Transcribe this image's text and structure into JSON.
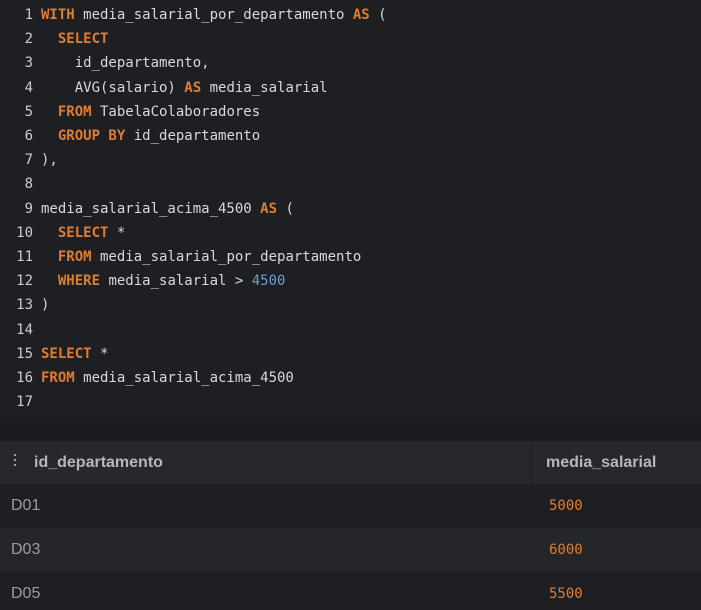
{
  "editor": {
    "lines": [
      {
        "num": "1",
        "tokens": [
          {
            "t": "kw",
            "v": "WITH"
          },
          {
            "t": "plain",
            "v": " media_salarial_por_departamento "
          },
          {
            "t": "kw",
            "v": "AS"
          },
          {
            "t": "plain",
            "v": " ("
          }
        ]
      },
      {
        "num": "2",
        "tokens": [
          {
            "t": "plain",
            "v": "  "
          },
          {
            "t": "kw",
            "v": "SELECT"
          }
        ]
      },
      {
        "num": "3",
        "tokens": [
          {
            "t": "plain",
            "v": "    id_departamento,"
          }
        ]
      },
      {
        "num": "4",
        "tokens": [
          {
            "t": "plain",
            "v": "    AVG(salario) "
          },
          {
            "t": "kw",
            "v": "AS"
          },
          {
            "t": "plain",
            "v": " media_salarial"
          }
        ]
      },
      {
        "num": "5",
        "tokens": [
          {
            "t": "plain",
            "v": "  "
          },
          {
            "t": "kw",
            "v": "FROM"
          },
          {
            "t": "plain",
            "v": " TabelaColaboradores"
          }
        ]
      },
      {
        "num": "6",
        "tokens": [
          {
            "t": "plain",
            "v": "  "
          },
          {
            "t": "kw",
            "v": "GROUP BY"
          },
          {
            "t": "plain",
            "v": " id_departamento"
          }
        ]
      },
      {
        "num": "7",
        "tokens": [
          {
            "t": "plain",
            "v": "),"
          }
        ]
      },
      {
        "num": "8",
        "tokens": []
      },
      {
        "num": "9",
        "tokens": [
          {
            "t": "plain",
            "v": "media_salarial_acima_4500 "
          },
          {
            "t": "kw",
            "v": "AS"
          },
          {
            "t": "plain",
            "v": " ("
          }
        ]
      },
      {
        "num": "10",
        "tokens": [
          {
            "t": "plain",
            "v": "  "
          },
          {
            "t": "kw",
            "v": "SELECT"
          },
          {
            "t": "plain",
            "v": " *"
          }
        ]
      },
      {
        "num": "11",
        "tokens": [
          {
            "t": "plain",
            "v": "  "
          },
          {
            "t": "kw",
            "v": "FROM"
          },
          {
            "t": "plain",
            "v": " media_salarial_por_departamento"
          }
        ]
      },
      {
        "num": "12",
        "tokens": [
          {
            "t": "plain",
            "v": "  "
          },
          {
            "t": "kw",
            "v": "WHERE"
          },
          {
            "t": "plain",
            "v": " media_salarial > "
          },
          {
            "t": "num",
            "v": "4500"
          }
        ]
      },
      {
        "num": "13",
        "tokens": [
          {
            "t": "plain",
            "v": ")"
          }
        ]
      },
      {
        "num": "14",
        "tokens": []
      },
      {
        "num": "15",
        "tokens": [
          {
            "t": "kw",
            "v": "SELECT"
          },
          {
            "t": "plain",
            "v": " *"
          }
        ]
      },
      {
        "num": "16",
        "tokens": [
          {
            "t": "kw",
            "v": "FROM"
          },
          {
            "t": "plain",
            "v": " media_salarial_acima_4500"
          }
        ]
      },
      {
        "num": "17",
        "tokens": []
      }
    ]
  },
  "results": {
    "columns": [
      "id_departamento",
      "media_salarial"
    ],
    "rows": [
      [
        "D01",
        "5000"
      ],
      [
        "D03",
        "6000"
      ],
      [
        "D05",
        "5500"
      ]
    ]
  },
  "colors": {
    "keyword": "#e07c33",
    "number": "#6d9ed9",
    "background": "#1e1f22"
  }
}
